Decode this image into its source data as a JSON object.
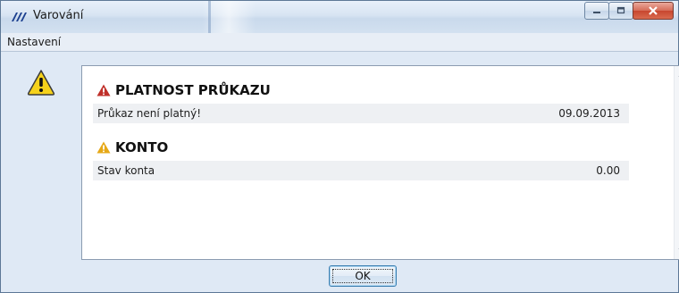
{
  "window": {
    "title": "Varování"
  },
  "menu": {
    "items": [
      "Nastavení"
    ]
  },
  "sections": [
    {
      "title": "PLATNOST PRŮKAZU",
      "icon": "warning-red-icon",
      "icon_color": "#c0302a",
      "rows": [
        {
          "label": "Průkaz není platný!",
          "value": "09.09.2013"
        }
      ]
    },
    {
      "title": "KONTO",
      "icon": "warning-yellow-icon",
      "icon_color": "#e6a817",
      "rows": [
        {
          "label": "Stav konta",
          "value": "0.00"
        }
      ]
    }
  ],
  "buttons": {
    "ok": "OK"
  },
  "colors": {
    "window_bg": "#dfe9f5",
    "row_bg": "#eef0f3",
    "close_button": "#c8462f"
  }
}
